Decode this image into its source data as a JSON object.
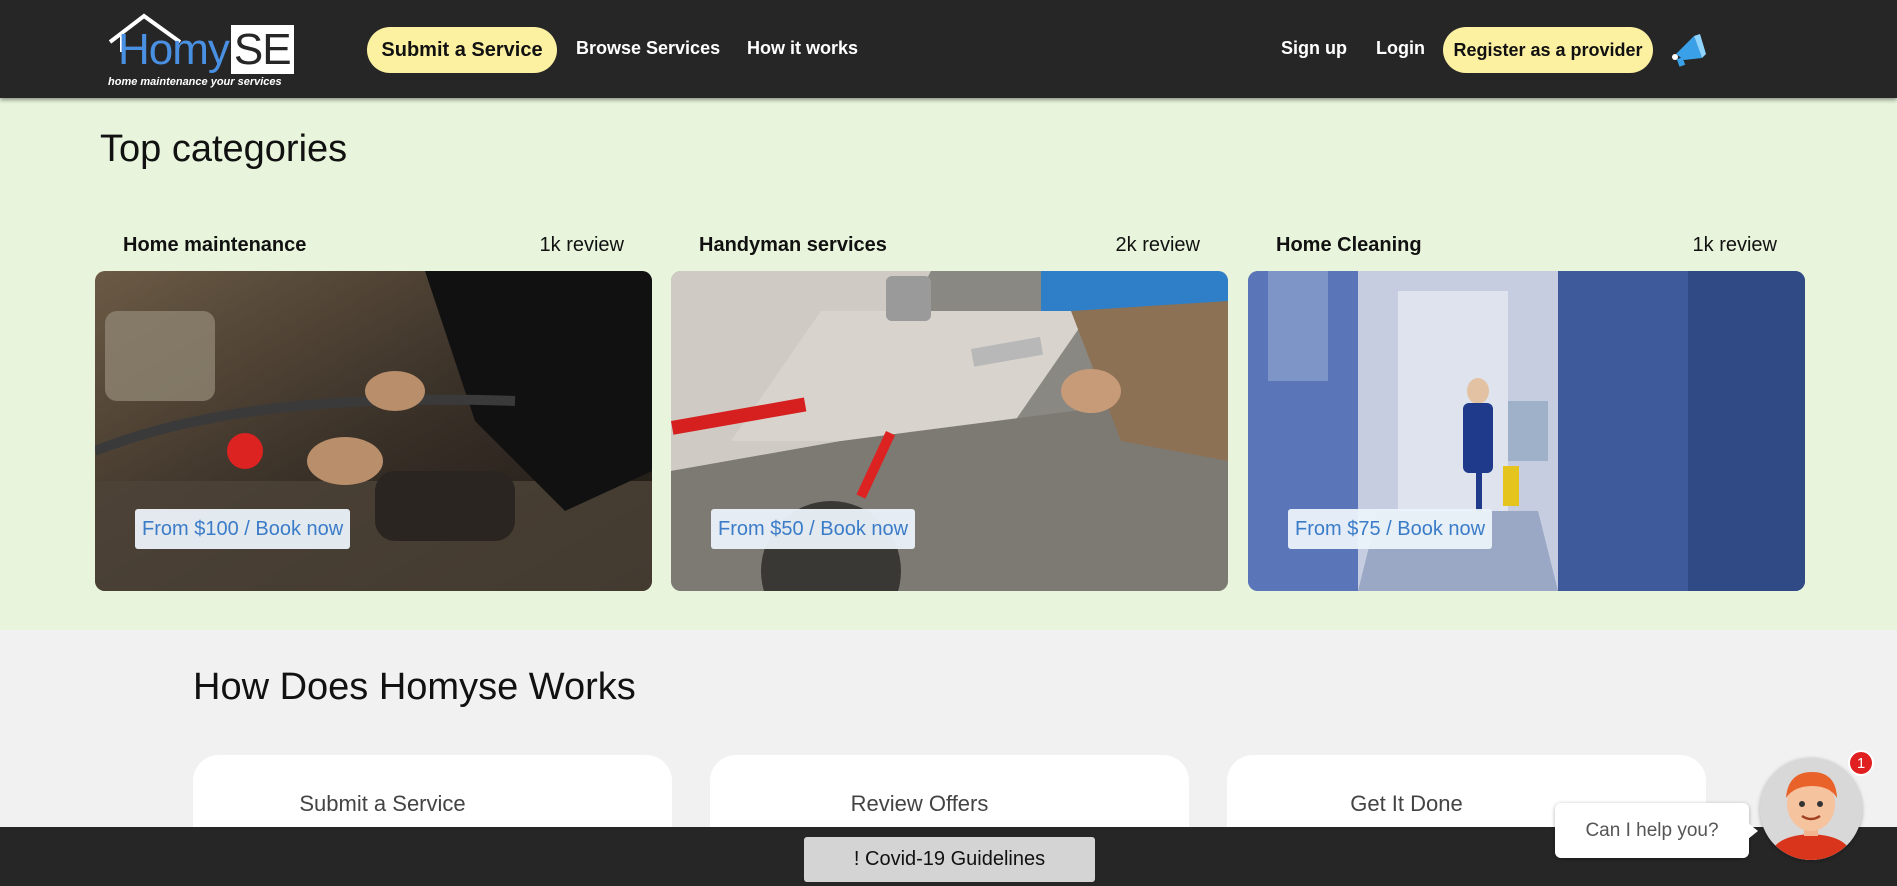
{
  "header": {
    "logo_text_a": "Homy",
    "logo_text_b": "SE",
    "logo_tagline": "home maintenance your services",
    "nav": {
      "submit_service": "Submit a Service",
      "browse_services": "Browse Services",
      "how_it_works": "How it works",
      "sign_up": "Sign up",
      "login": "Login",
      "register_provider": "Register as a provider"
    },
    "promo_icon": "megaphone-icon"
  },
  "top_categories": {
    "title": "Top categories",
    "items": [
      {
        "name": "Home maintenance",
        "reviews": "1k review",
        "price": "From $100 / Book now"
      },
      {
        "name": "Handyman services",
        "reviews": "2k review",
        "price": "From $50 / Book now"
      },
      {
        "name": "Home Cleaning",
        "reviews": "1k review",
        "price": "From $75 / Book now"
      }
    ]
  },
  "how_it_works": {
    "title": "How Does Homyse Works",
    "steps": [
      {
        "title": "Submit a Service"
      },
      {
        "title": "Review Offers"
      },
      {
        "title": "Get It Done"
      }
    ]
  },
  "footer_bar": {
    "covid_button": "! Covid-19 Guidelines"
  },
  "chat": {
    "prompt": "Can I help you?",
    "badge_count": "1"
  },
  "colors": {
    "header_bg": "#262626",
    "accent_yellow": "#fcf1a1",
    "categories_bg": "#e8f5dc",
    "link_blue": "#3b7cc8"
  }
}
